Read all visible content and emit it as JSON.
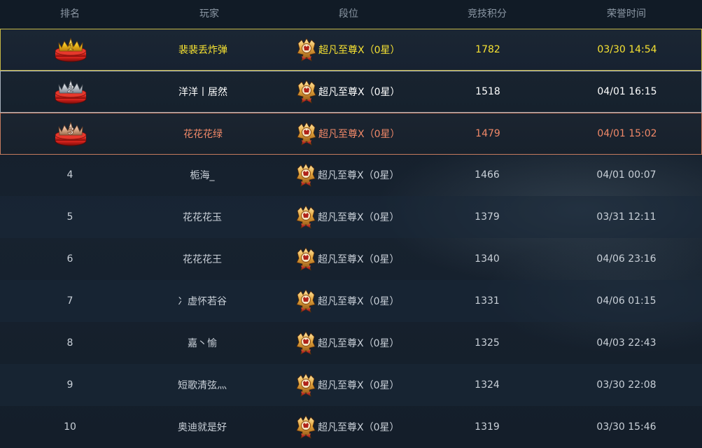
{
  "columns": {
    "rank": "排名",
    "player": "玩家",
    "tier": "段位",
    "score": "竞技积分",
    "time": "荣誉时间"
  },
  "colors": {
    "first": "#f6e232",
    "second": "#ffffff",
    "third": "#f08868",
    "normal": "#c9d0d8",
    "header": "#8b97a4"
  },
  "rows": [
    {
      "rank": "1",
      "player": "裴裴丢炸弹",
      "tier": "超凡至尊Ⅹ（0星）",
      "score": "1782",
      "time": "03/30 14:54",
      "icon": "gold-medal-icon"
    },
    {
      "rank": "2",
      "player": "洋洋丨居然",
      "tier": "超凡至尊Ⅹ（0星）",
      "score": "1518",
      "time": "04/01 16:15",
      "icon": "silver-medal-icon"
    },
    {
      "rank": "3",
      "player": "花花花绿",
      "tier": "超凡至尊Ⅹ（0星）",
      "score": "1479",
      "time": "04/01 15:02",
      "icon": "bronze-medal-icon"
    },
    {
      "rank": "4",
      "player": "栀海_",
      "tier": "超凡至尊Ⅹ（0星）",
      "score": "1466",
      "time": "04/01 00:07"
    },
    {
      "rank": "5",
      "player": "花花花玉",
      "tier": "超凡至尊Ⅹ（0星）",
      "score": "1379",
      "time": "03/31 12:11"
    },
    {
      "rank": "6",
      "player": "花花花王",
      "tier": "超凡至尊Ⅹ（0星）",
      "score": "1340",
      "time": "04/06 23:16"
    },
    {
      "rank": "7",
      "player": "冫虚怀若谷",
      "tier": "超凡至尊Ⅹ（0星）",
      "score": "1331",
      "time": "04/06 01:15"
    },
    {
      "rank": "8",
      "player": "嘉丶愉",
      "tier": "超凡至尊Ⅹ（0星）",
      "score": "1325",
      "time": "04/03 22:43"
    },
    {
      "rank": "9",
      "player": "短歌清弦灬",
      "tier": "超凡至尊Ⅹ（0星）",
      "score": "1324",
      "time": "03/30 22:08"
    },
    {
      "rank": "10",
      "player": "奥迪就是好",
      "tier": "超凡至尊Ⅹ（0星）",
      "score": "1319",
      "time": "03/30 15:46"
    }
  ]
}
